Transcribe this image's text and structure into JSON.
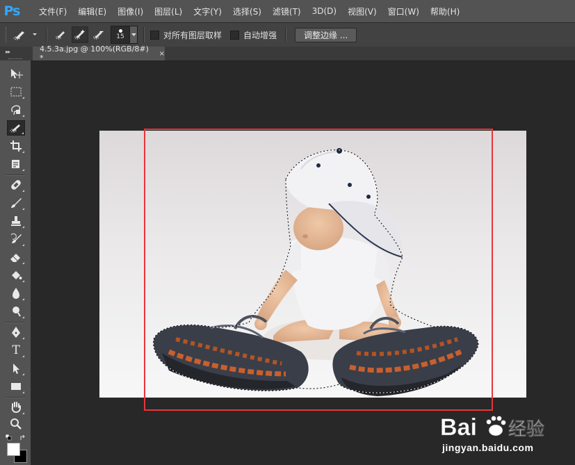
{
  "app": {
    "logo": "Ps"
  },
  "menu": [
    "文件(F)",
    "编辑(E)",
    "图像(I)",
    "图层(L)",
    "文字(Y)",
    "选择(S)",
    "滤镜(T)",
    "3D(D)",
    "视图(V)",
    "窗口(W)",
    "帮助(H)"
  ],
  "options": {
    "brush_size": "15",
    "sample_all_layers_label": "对所有图层取样",
    "sample_all_layers_checked": false,
    "auto_enhance_label": "自动增强",
    "auto_enhance_checked": false,
    "refine_edge_label": "调整边缘 ..."
  },
  "panel": {
    "collapse_glyph": "▸▸"
  },
  "document": {
    "tab_title": "4.5.3a.jpg @ 100%(RGB/8#) *",
    "close_glyph": "×"
  },
  "tools": [
    {
      "icon": "move-icon"
    },
    {
      "icon": "marquee-icon"
    },
    {
      "icon": "lasso-icon"
    },
    {
      "icon": "quick-selection-icon",
      "active": true
    },
    {
      "icon": "crop-icon"
    },
    {
      "icon": "eyedropper-icon"
    },
    {
      "icon": "healing-brush-icon"
    },
    {
      "icon": "brush-icon"
    },
    {
      "icon": "clone-stamp-icon"
    },
    {
      "icon": "history-brush-icon"
    },
    {
      "icon": "eraser-icon"
    },
    {
      "icon": "paint-bucket-icon"
    },
    {
      "icon": "blur-icon"
    },
    {
      "icon": "dodge-icon"
    },
    {
      "icon": "pen-icon"
    },
    {
      "icon": "type-icon"
    },
    {
      "icon": "path-selection-icon"
    },
    {
      "icon": "rectangle-icon"
    },
    {
      "icon": "hand-icon"
    },
    {
      "icon": "zoom-icon"
    }
  ],
  "type_tool_glyph": "T",
  "colors": {
    "foreground": "#ffffff",
    "background": "#000000",
    "highlight": "#e8353b",
    "ps_blue": "#31a8ff"
  },
  "watermark": {
    "brand": "Bai 经验",
    "url": "jingyan.baidu.com"
  }
}
